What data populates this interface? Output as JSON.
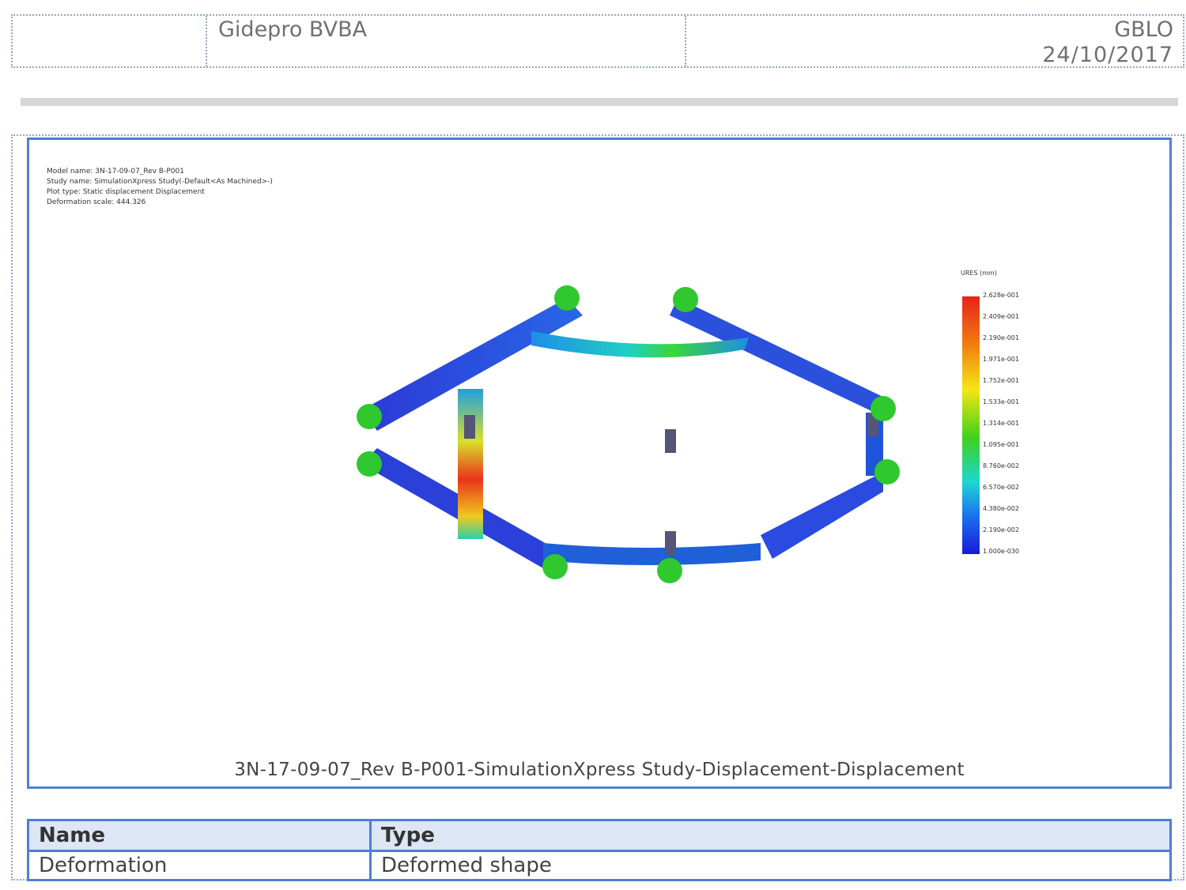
{
  "header": {
    "company": "Gidepro BVBA",
    "author": "GBLO",
    "date": "24/10/2017"
  },
  "figure": {
    "info_lines": [
      "Model name: 3N-17-09-07_Rev B-P001",
      "Study name: SimulationXpress Study(-Default<As Machined>-)",
      "Plot type: Static displacement Displacement",
      "Deformation scale: 444.326"
    ],
    "legend_title": "URES (mm)",
    "legend_ticks": [
      "2.628e-001",
      "2.409e-001",
      "2.190e-001",
      "1.971e-001",
      "1.752e-001",
      "1.533e-001",
      "1.314e-001",
      "1.095e-001",
      "8.760e-002",
      "6.570e-002",
      "4.380e-002",
      "2.190e-002",
      "1.000e-030"
    ],
    "colors": {
      "max": "#e8221a",
      "min": "#1a1ad8"
    },
    "caption": "3N-17-09-07_Rev B-P001-SimulationXpress Study-Displacement-Displacement"
  },
  "table": {
    "headers": [
      "Name",
      "Type"
    ],
    "rows": [
      [
        "Deformation",
        "Deformed shape"
      ]
    ]
  }
}
